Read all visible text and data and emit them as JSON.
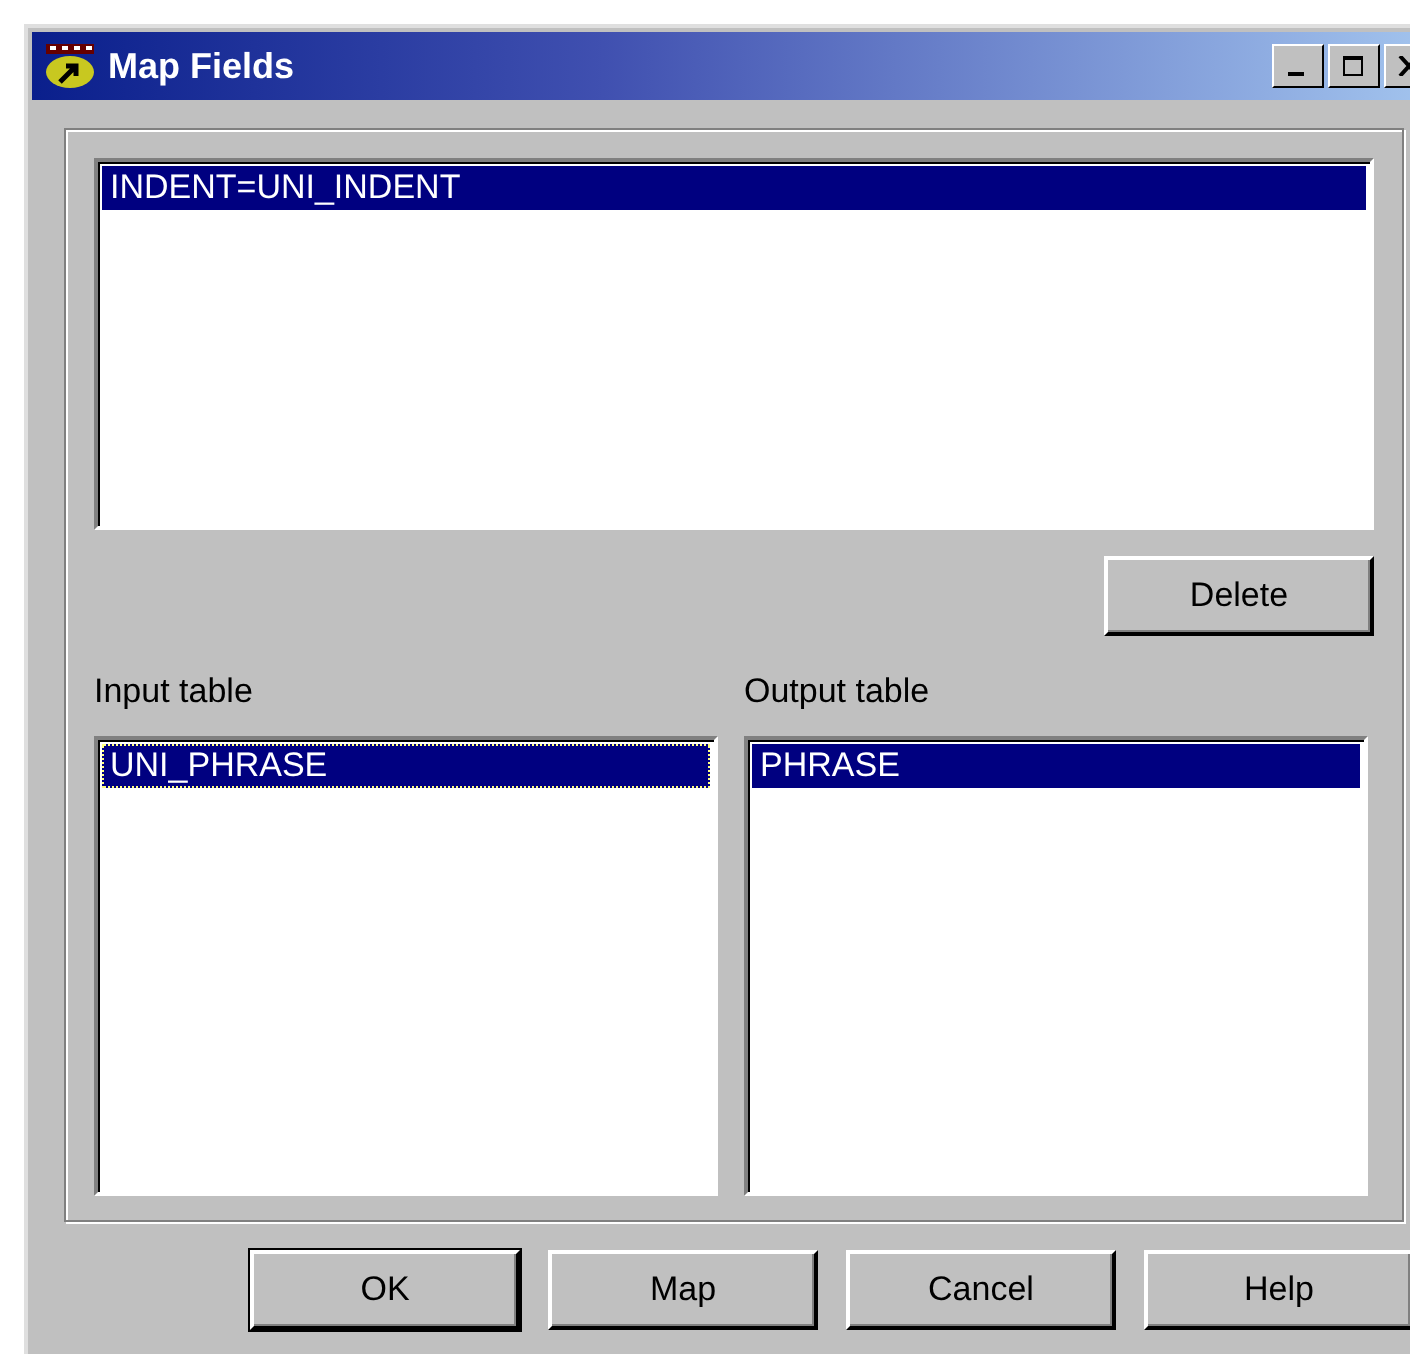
{
  "window": {
    "title": "Map Fields"
  },
  "mappings": {
    "items": [
      {
        "text": "INDENT=UNI_INDENT",
        "selected": true
      }
    ]
  },
  "delete_button": {
    "label": "Delete"
  },
  "input_table": {
    "label": "Input table",
    "items": [
      {
        "text": "UNI_PHRASE",
        "selected": true,
        "focused": true
      }
    ]
  },
  "output_table": {
    "label": "Output table",
    "items": [
      {
        "text": "PHRASE",
        "selected": true,
        "focused": false
      }
    ]
  },
  "buttons": [
    {
      "label": "OK",
      "default": true
    },
    {
      "label": "Map",
      "default": false
    },
    {
      "label": "Cancel",
      "default": false
    },
    {
      "label": "Help",
      "default": false
    }
  ]
}
